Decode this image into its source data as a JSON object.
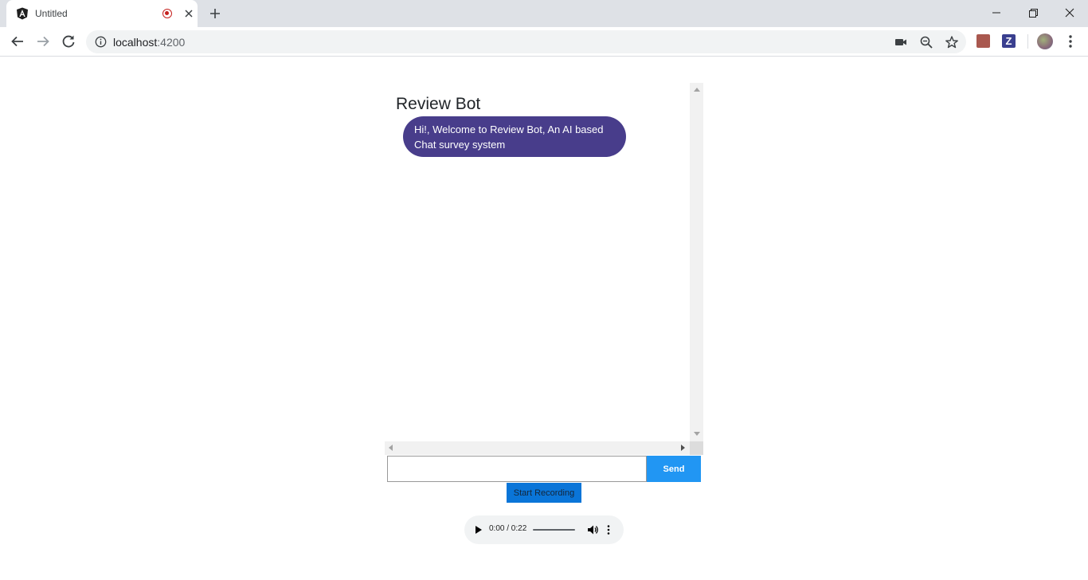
{
  "browser": {
    "tab": {
      "title": "Untitled",
      "favicon": "angular-icon",
      "recording_indicator": "recording-icon",
      "close_icon": "close-icon"
    },
    "new_tab_icon": "plus-icon",
    "window_controls": [
      "minimize-icon",
      "restore-icon",
      "close-icon"
    ],
    "nav": [
      "back-icon",
      "forward-icon",
      "reload-icon"
    ],
    "address": {
      "host": "localhost",
      "port": ":4200"
    },
    "omnibox_icons": [
      "camera-icon",
      "zoom-out-icon",
      "star-icon"
    ],
    "extensions": [
      {
        "name": "pdf-extension-icon",
        "color": "#a9584f"
      },
      {
        "name": "z-extension-icon",
        "label": "Z",
        "color": "#3a3f8f"
      }
    ],
    "profile": "avatar",
    "menu": "more-vertical-icon"
  },
  "chat": {
    "title": "Review Bot",
    "messages": [
      {
        "sender": "bot",
        "text": "Hi!, Welcome to Review Bot, An AI based Chat survey system",
        "color": "#483d8b"
      }
    ],
    "input": {
      "value": "",
      "placeholder": ""
    },
    "send_label": "Send",
    "send_color": "#2196f3",
    "record_label": "Start Recording",
    "record_color": "#0a75d8"
  },
  "audio_player": {
    "time": "0:00 / 0:22",
    "progress": 0
  }
}
